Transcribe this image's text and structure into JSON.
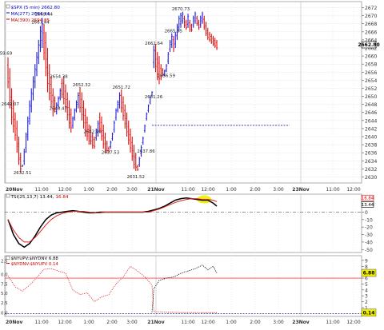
{
  "chart_data": [
    {
      "type": "bar",
      "panel": "price",
      "title": "$SPX (5 min) 2662.80",
      "legend": [
        {
          "text": "$SPX (5 min) 2662.80",
          "color": "#0000cc",
          "swatch": "checkbox"
        },
        {
          "text": "MA(277) 2694.44",
          "color": "#0000cc",
          "swatch": "line"
        },
        {
          "text": "MA(390) 2694.85",
          "color": "#cc0000",
          "swatch": "line"
        }
      ],
      "last_value_tag": "2662.80",
      "y_ticks": [
        2630,
        2632,
        2634,
        2636,
        2638,
        2640,
        2642,
        2644,
        2646,
        2648,
        2650,
        2652,
        2654,
        2656,
        2658,
        2660,
        2662,
        2664,
        2666,
        2668,
        2670,
        2672
      ],
      "ylim": [
        2628.5,
        2673.5
      ],
      "x_ticks": [
        "20Nov",
        "11:00",
        "12:00",
        "1:00",
        "2:00",
        "3:00",
        "21Nov",
        "11:00",
        "12:00",
        "1:00",
        "2:00",
        "3:00",
        "23Nov",
        "11:00",
        "12:00"
      ],
      "x_ticks_bold": [
        "20Nov",
        "21Nov",
        "23Nov"
      ],
      "reference_level": 2642.8,
      "annotations": [
        "2659.69",
        "2649.07",
        "2632.51",
        "2669.44",
        "2667.44",
        "2648.47",
        "2654.38",
        "2652.32",
        "2642.70",
        "2637.53",
        "2651.72",
        "2631.52",
        "2637.86",
        "2662.64",
        "2665.65",
        "2651.26",
        "2656.59",
        "2670.73"
      ],
      "colors": {
        "up": "#2020dd",
        "down": "#dd1010",
        "neutral": "#10a010",
        "reference": "#000099",
        "ma277": "#0000cc",
        "ma390": "#cc0000"
      },
      "x": [
        0,
        1,
        2,
        3,
        4,
        5,
        6,
        7,
        8,
        9,
        10,
        11,
        12,
        13,
        14,
        15,
        16,
        17,
        18,
        19,
        20,
        21,
        22,
        23,
        24,
        25,
        26,
        27,
        28,
        29,
        30,
        31,
        32,
        33,
        34,
        35,
        36,
        37,
        38,
        39,
        40,
        41,
        42,
        43,
        44,
        45,
        46,
        47,
        48,
        49,
        50,
        51,
        52,
        53,
        54,
        55,
        56,
        57,
        58,
        59,
        60,
        61,
        62,
        63,
        64,
        65,
        66,
        67,
        68,
        69,
        70,
        71,
        72,
        73,
        74,
        75,
        76,
        77,
        78,
        79,
        80,
        81,
        82,
        83,
        84,
        85,
        86,
        87,
        88,
        89,
        90,
        91,
        92,
        93,
        94,
        95,
        96,
        97,
        98,
        99,
        100,
        101,
        102,
        103,
        104,
        105,
        106,
        107,
        108,
        109,
        110,
        111,
        112,
        113,
        114,
        115,
        116
      ],
      "high": [
        2659.69,
        2657.0,
        2652.0,
        2649.07,
        2646.0,
        2644.0,
        2640.0,
        2636.0,
        2633.0,
        2637.0,
        2641.0,
        2645.0,
        2649.0,
        2652.0,
        2655.0,
        2658.0,
        2661.0,
        2664.0,
        2667.44,
        2669.44,
        2668.0,
        2666.0,
        2662.0,
        2658.0,
        2655.0,
        2652.0,
        2650.0,
        2648.47,
        2650.0,
        2652.0,
        2654.38,
        2655.0,
        2653.0,
        2651.0,
        2649.0,
        2647.0,
        2645.0,
        2647.0,
        2649.0,
        2651.0,
        2652.32,
        2651.0,
        2649.0,
        2647.0,
        2645.0,
        2643.0,
        2642.7,
        2641.0,
        2640.0,
        2642.0,
        2644.0,
        2646.0,
        2645.0,
        2643.0,
        2641.0,
        2639.0,
        2637.53,
        2639.0,
        2641.0,
        2644.0,
        2647.0,
        2649.0,
        2651.0,
        2651.72,
        2650.0,
        2648.0,
        2646.0,
        2644.0,
        2642.0,
        2640.0,
        2638.0,
        2636.0,
        2633.0,
        2635.0,
        2637.86,
        2640.0,
        2643.0,
        2646.0,
        2648.0,
        2650.0,
        2651.26,
        2662.64,
        2663.0,
        2661.0,
        2660.0,
        2658.0,
        2657.0,
        2656.59,
        2658.0,
        2661.0,
        2664.0,
        2665.65,
        2665.0,
        2666.0,
        2668.0,
        2670.0,
        2670.73,
        2671.0,
        2670.0,
        2669.0,
        2670.5,
        2669.0,
        2668.0,
        2670.0,
        2671.0,
        2670.0,
        2669.0,
        2670.0,
        2671.0,
        2670.0,
        2668.5,
        2667.0,
        2666.0,
        2665.5,
        2665.0,
        2664.5,
        2664.0
      ],
      "low": [
        2652.0,
        2647.0,
        2643.0,
        2641.0,
        2639.0,
        2636.0,
        2633.0,
        2631.0,
        2632.51,
        2633.0,
        2636.0,
        2639.0,
        2643.0,
        2646.0,
        2649.0,
        2652.0,
        2655.0,
        2658.0,
        2661.0,
        2662.0,
        2659.0,
        2655.0,
        2651.0,
        2649.0,
        2647.0,
        2645.0,
        2646.0,
        2645.5,
        2647.0,
        2649.0,
        2649.5,
        2648.0,
        2646.0,
        2644.0,
        2642.0,
        2641.0,
        2642.0,
        2644.0,
        2646.0,
        2647.0,
        2646.0,
        2644.0,
        2642.0,
        2640.0,
        2639.0,
        2638.0,
        2638.0,
        2637.0,
        2637.0,
        2639.0,
        2640.0,
        2641.0,
        2639.0,
        2637.0,
        2636.0,
        2636.0,
        2636.0,
        2637.0,
        2639.0,
        2641.0,
        2644.0,
        2646.0,
        2647.0,
        2646.0,
        2644.0,
        2642.0,
        2640.0,
        2638.0,
        2636.0,
        2634.0,
        2632.0,
        2631.52,
        2631.5,
        2632.5,
        2635.0,
        2638.0,
        2641.0,
        2644.0,
        2646.0,
        2648.0,
        2650.0,
        2657.0,
        2656.0,
        2654.0,
        2653.0,
        2654.0,
        2655.0,
        2655.0,
        2656.0,
        2658.0,
        2661.0,
        2662.0,
        2661.0,
        2662.0,
        2664.0,
        2666.0,
        2667.0,
        2668.0,
        2667.0,
        2666.5,
        2667.0,
        2666.0,
        2666.0,
        2667.0,
        2668.0,
        2667.5,
        2666.5,
        2667.0,
        2668.0,
        2666.5,
        2665.0,
        2664.0,
        2663.5,
        2663.0,
        2662.5,
        2662.0,
        2661.5
      ],
      "up": [
        false,
        false,
        false,
        false,
        false,
        false,
        false,
        false,
        true,
        true,
        true,
        true,
        true,
        true,
        true,
        true,
        true,
        true,
        true,
        true,
        false,
        false,
        false,
        false,
        false,
        false,
        false,
        true,
        true,
        true,
        false,
        false,
        false,
        false,
        false,
        false,
        true,
        true,
        true,
        true,
        false,
        false,
        false,
        false,
        false,
        false,
        false,
        false,
        false,
        true,
        true,
        false,
        false,
        false,
        false,
        false,
        false,
        true,
        true,
        true,
        true,
        true,
        true,
        false,
        false,
        false,
        false,
        false,
        false,
        false,
        false,
        false,
        false,
        true,
        true,
        true,
        true,
        true,
        true,
        true,
        true,
        true,
        false,
        false,
        false,
        false,
        false,
        true,
        true,
        true,
        true,
        true,
        false,
        true,
        true,
        true,
        true,
        true,
        false,
        false,
        true,
        false,
        false,
        true,
        true,
        false,
        false,
        true,
        true,
        false,
        false,
        false,
        false,
        false,
        false,
        false,
        false
      ]
    },
    {
      "type": "line",
      "panel": "tsi",
      "legend": [
        {
          "text": "TSI(25,13,7) 13.44,",
          "color": "#000000"
        },
        {
          "text": "16.84",
          "color": "#cc0000"
        }
      ],
      "tags": [
        "16.84",
        "13.44"
      ],
      "y_ticks": [
        -50,
        -40,
        -30,
        -20,
        -10,
        0,
        10,
        20
      ],
      "ylim": [
        -54,
        24
      ],
      "reference_level": 0,
      "colors": {
        "tsi": "#000000",
        "signal": "#dd2222",
        "highlight": "#f0f000"
      },
      "x": [
        0,
        3,
        6,
        9,
        12,
        15,
        18,
        21,
        24,
        27,
        30,
        33,
        36,
        39,
        42,
        45,
        48,
        51,
        54,
        57,
        60,
        63,
        66,
        69,
        72,
        75,
        78,
        81,
        84,
        87,
        90,
        93,
        96,
        99,
        102,
        105,
        108,
        111,
        114,
        116
      ],
      "series": [
        {
          "name": "TSI",
          "values": [
            -10,
            -30,
            -42,
            -47,
            -42,
            -32,
            -20,
            -10,
            -4,
            -1,
            0,
            1,
            2,
            1,
            0,
            -1,
            -1,
            0,
            0,
            0,
            0,
            0,
            0,
            0,
            0,
            0,
            1,
            3,
            5,
            8,
            12,
            16,
            18,
            19,
            18,
            17,
            16,
            16,
            12,
            8
          ]
        },
        {
          "name": "Signal",
          "values": [
            -10,
            -24,
            -34,
            -40,
            -40,
            -34,
            -26,
            -17,
            -10,
            -5,
            -2,
            0,
            1,
            1,
            1,
            0,
            -1,
            -1,
            0,
            0,
            0,
            0,
            0,
            0,
            0,
            0,
            0,
            2,
            4,
            7,
            10,
            13,
            15,
            17,
            18,
            18,
            17,
            17,
            16,
            14
          ]
        }
      ]
    },
    {
      "type": "line",
      "panel": "breadth",
      "legend": [
        {
          "text": "$NYUPV:$NYDNV 6.88",
          "color": "#000000",
          "swatch": "checkbox"
        },
        {
          "text": "$NYDNV:$NYUPV 0.14",
          "color": "#cc0000",
          "swatch": "line"
        }
      ],
      "tags": [
        "6.88",
        "0.14"
      ],
      "y_ticks_left": [
        "2.5",
        "0.0",
        "7.5",
        "5.0",
        "2.5",
        "0.0"
      ],
      "y_ticks": [
        0,
        1,
        2,
        3,
        4,
        5,
        6,
        7,
        8,
        9
      ],
      "ylim": [
        -0.5,
        9.8
      ],
      "reference_level": 6,
      "colors": {
        "breadth": "#000000",
        "inverse": "#dd2222",
        "reference": "#ff4444",
        "baseline": "#000099",
        "highlight": "#f0f000"
      },
      "x": [
        0,
        4,
        8,
        12,
        16,
        20,
        24,
        28,
        32,
        36,
        40,
        44,
        48,
        52,
        56,
        60,
        64,
        68,
        72,
        76,
        80,
        81,
        84,
        88,
        92,
        96,
        100,
        104,
        108,
        111,
        114,
        116
      ],
      "series": [
        {
          "name": "$NYUPV:$NYDNV",
          "values": [
            null,
            null,
            null,
            null,
            null,
            null,
            null,
            null,
            null,
            null,
            null,
            null,
            null,
            null,
            null,
            null,
            null,
            null,
            null,
            null,
            0.2,
            4.2,
            5.6,
            6.0,
            6.2,
            6.8,
            7.2,
            7.6,
            8.2,
            7.4,
            8.0,
            6.88
          ]
        },
        {
          "name": "$NYDNV:$NYUPV",
          "values": [
            6.4,
            4.5,
            3.8,
            4.8,
            6.1,
            7.5,
            7.6,
            7.2,
            6.8,
            4.0,
            3.2,
            3.5,
            2.0,
            2.8,
            3.2,
            5.0,
            6.2,
            8.0,
            7.2,
            6.2,
            4.8,
            0.3,
            0.3,
            0.2,
            0.2,
            0.15,
            0.15,
            0.15,
            0.14,
            0.14,
            0.14,
            0.14
          ]
        }
      ]
    }
  ]
}
